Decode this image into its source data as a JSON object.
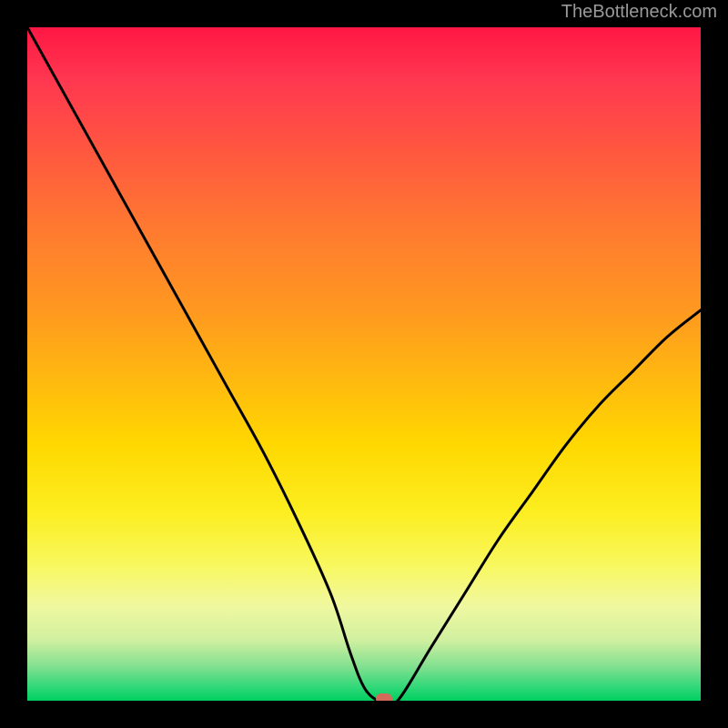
{
  "watermark": "TheBottleneck.com",
  "chart_data": {
    "type": "line",
    "title": "",
    "xlabel": "",
    "ylabel": "",
    "xlim": [
      0,
      100
    ],
    "ylim": [
      0,
      100
    ],
    "x": [
      0,
      5,
      10,
      15,
      20,
      25,
      30,
      35,
      40,
      45,
      48,
      50,
      52,
      53,
      55,
      60,
      65,
      70,
      75,
      80,
      85,
      90,
      95,
      100
    ],
    "y": [
      100,
      91,
      82,
      73,
      64,
      55,
      46,
      37,
      27,
      16,
      7,
      2,
      0,
      0,
      0,
      8,
      16,
      24,
      31,
      38,
      44,
      49,
      54,
      58
    ],
    "marker": {
      "x": 53,
      "y": 0
    },
    "background_gradient": {
      "stops": [
        {
          "pos": 0.0,
          "color": "#ff1744"
        },
        {
          "pos": 0.5,
          "color": "#ffb000"
        },
        {
          "pos": 0.8,
          "color": "#f8f860"
        },
        {
          "pos": 1.0,
          "color": "#00d060"
        }
      ]
    }
  }
}
